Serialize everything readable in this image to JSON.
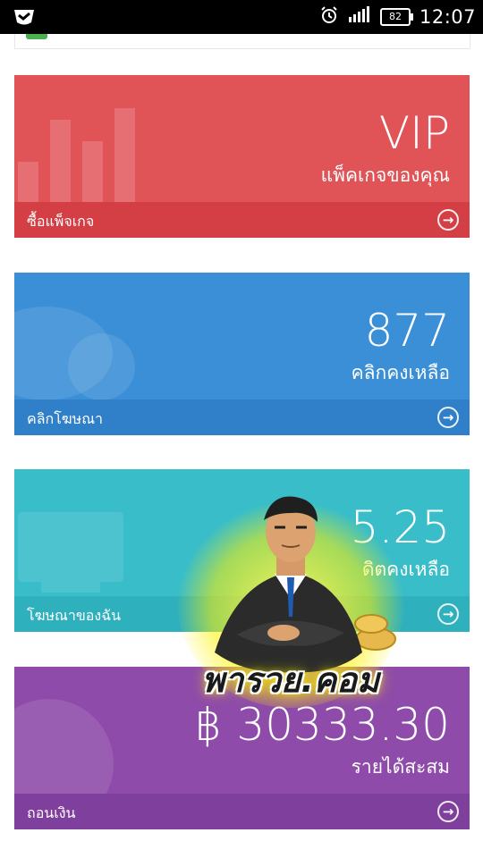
{
  "status_bar": {
    "app_icon": "app-badge-icon",
    "battery": "82",
    "time": "12:07"
  },
  "cards": {
    "vip": {
      "value": "VIP",
      "subtitle": "แพ็คเกจของคุณ",
      "footer": "ซื้อแพ็จเกจ",
      "color": "#e05458"
    },
    "clicks": {
      "value": "877",
      "subtitle": "คลิกคงเหลือ",
      "footer": "คลิกโฆษณา",
      "color": "#3a8fd6"
    },
    "credit": {
      "value": "5.25",
      "subtitle": "ดิตคงเหลือ",
      "footer": "โฆษณาของฉัน",
      "color": "#38bdc9"
    },
    "income": {
      "value": "฿ 30333.30",
      "subtitle": "รายได้สะสม",
      "footer": "ถอนเงิน",
      "color": "#8e4ba9"
    }
  },
  "watermark": {
    "text": "พารวย.คอม"
  }
}
